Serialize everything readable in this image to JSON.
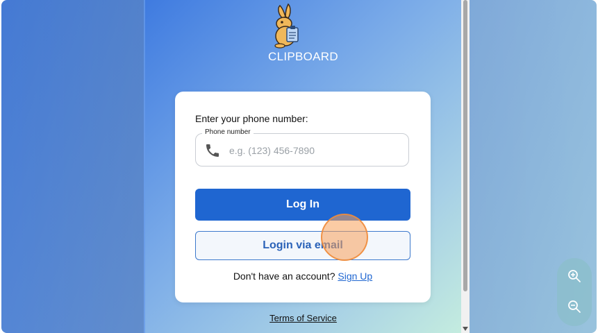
{
  "brand": {
    "name": "CLIPBOARD",
    "logo_icon": "rabbit-clipboard-logo"
  },
  "login_card": {
    "prompt": "Enter your phone number:",
    "phone_field": {
      "label": "Phone number",
      "placeholder": "e.g. (123) 456-7890",
      "value": "",
      "icon": "phone-icon"
    },
    "login_button": "Log In",
    "email_button": "Login via email",
    "signup_prompt": "Don't have an account?",
    "signup_link": "Sign Up"
  },
  "footer": {
    "terms_link": "Terms of Service"
  },
  "zoom_controls": {
    "zoom_in_icon": "zoom-in-icon",
    "zoom_out_icon": "zoom-out-icon"
  },
  "colors": {
    "primary": "#1f66d1",
    "secondary_border": "#3b78cc",
    "click_marker": "#f7a05a"
  }
}
